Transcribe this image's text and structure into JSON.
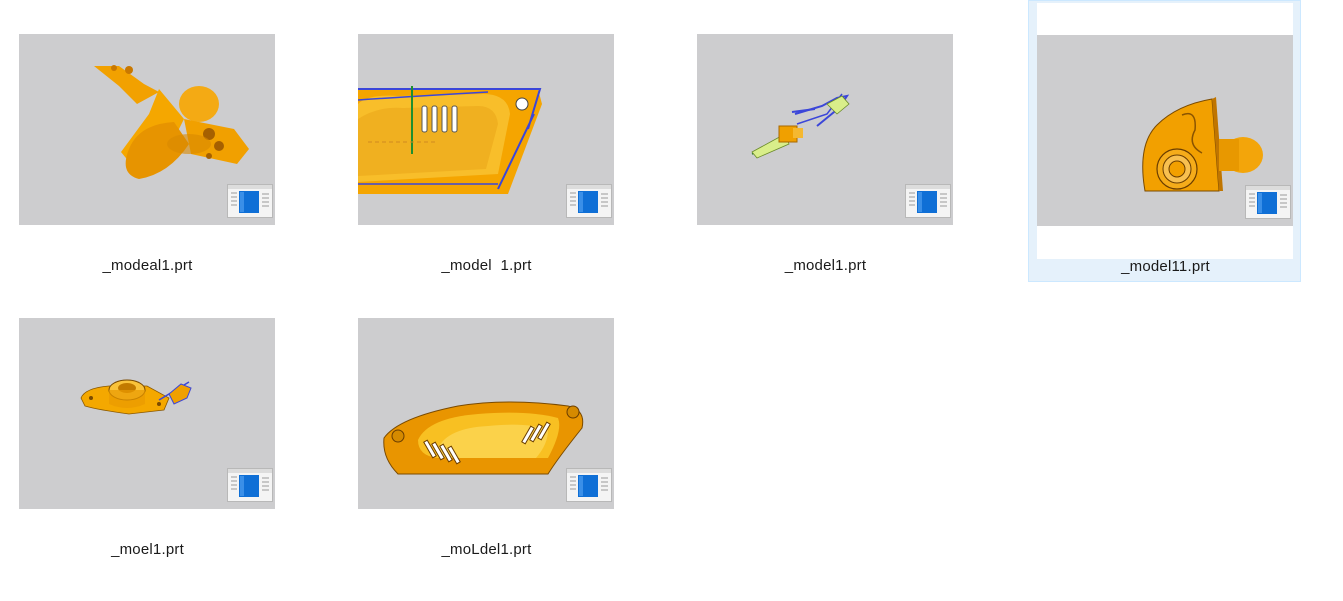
{
  "files": [
    {
      "name": "_modeal1.prt",
      "icon": "nx-part-document-icon",
      "thumbnail": "orange-linkage-part"
    },
    {
      "name": "_model  1.prt",
      "icon": "nx-part-document-icon",
      "thumbnail": "orange-cover-section-with-vents"
    },
    {
      "name": "_model1.prt",
      "icon": "nx-part-document-icon",
      "thumbnail": "small-wireframe-assembly"
    },
    {
      "name": "_model11.prt",
      "icon": "nx-part-document-icon",
      "thumbnail": "orange-bracket-with-knob",
      "selected": true
    },
    {
      "name": "_moel1.prt",
      "icon": "nx-part-document-icon",
      "thumbnail": "orange-flange-part"
    },
    {
      "name": "_moLdel1.prt",
      "icon": "nx-part-document-icon",
      "thumbnail": "orange-vented-cover"
    }
  ],
  "colors": {
    "thumbnail_background": "#cdcdcf",
    "part_orange": "#f5a000",
    "part_dark_orange": "#c97800",
    "selection_background": "#e5f1fb",
    "selection_border": "#cce8ff",
    "icon_blue": "#0f6fd6"
  }
}
